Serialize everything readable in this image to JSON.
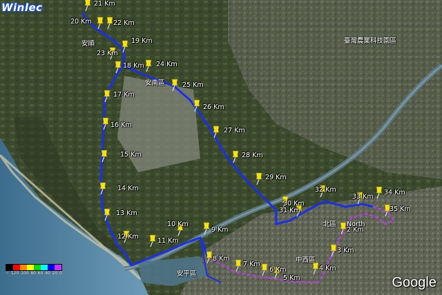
{
  "logo": "Winlec",
  "google_logo": "Google",
  "route_color": "#1a2fe8",
  "route_alt_color": "#b040e0",
  "pin_color": "#f2e21a",
  "legend": {
    "colors": [
      "#000000",
      "#ff0000",
      "#ff8800",
      "#ffff00",
      "#00dd00",
      "#00ffff",
      "#0000ff",
      "#cc33ff"
    ],
    "ticks": [
      "~",
      "120",
      "100",
      "80",
      "60",
      "40",
      "20",
      "0"
    ]
  },
  "place_labels": {
    "anshun": "安順",
    "anshun_district": "安南區",
    "north_district": "北區",
    "north_en": "North",
    "west_central": "中西區",
    "anping": "安平區",
    "factory": "臺灣農業科技園區"
  },
  "km_markers": [
    {
      "label": "5 Km"
    },
    {
      "label": "6 Km"
    },
    {
      "label": "7 Km"
    },
    {
      "label": "8 Km"
    },
    {
      "label": "9 Km"
    },
    {
      "label": "10 Km"
    },
    {
      "label": "11 Km"
    },
    {
      "label": "12 Km"
    },
    {
      "label": "13 Km"
    },
    {
      "label": "14 Km"
    },
    {
      "label": "15 Km"
    },
    {
      "label": "16 Km"
    },
    {
      "label": "17 Km"
    },
    {
      "label": "18 Km"
    },
    {
      "label": "19 Km"
    },
    {
      "label": "20 Km"
    },
    {
      "label": "21 Km"
    },
    {
      "label": "22 Km"
    },
    {
      "label": "23 Km"
    },
    {
      "label": "24 Km"
    },
    {
      "label": "25 Km"
    },
    {
      "label": "26 Km"
    },
    {
      "label": "27 Km"
    },
    {
      "label": "28 Km"
    },
    {
      "label": "29 Km"
    },
    {
      "label": "30 Km"
    },
    {
      "label": "31 Km"
    },
    {
      "label": "32 Km"
    },
    {
      "label": "33 Km"
    },
    {
      "label": "34 Km"
    },
    {
      "label": "35 Km"
    },
    {
      "label": "2 Km"
    },
    {
      "label": "3 Km"
    },
    {
      "label": "4 Km"
    }
  ]
}
